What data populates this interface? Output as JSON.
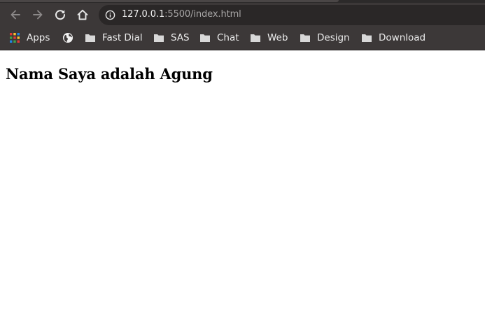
{
  "colors": {
    "chrome_bg": "#3c3838",
    "omnibox_bg": "#2a2727",
    "url_host": "#f1f1f1",
    "url_rest": "#a8a6a6",
    "icon": "#e8e8e8",
    "icon_disabled": "#8b8888",
    "page_bg": "#ffffff",
    "heading": "#000000"
  },
  "toolbar": {
    "back_icon": "arrow-left-icon",
    "forward_icon": "arrow-right-icon",
    "reload_icon": "reload-icon",
    "home_icon": "home-icon"
  },
  "omnibox": {
    "security_icon": "info-icon",
    "url_host": "127.0.0.1",
    "url_rest": ":5500/index.html"
  },
  "bookmarks": [
    {
      "label": "Apps",
      "icon": "apps-grid-icon"
    },
    {
      "label": "",
      "icon": "globe-icon"
    },
    {
      "label": "Fast Dial",
      "icon": "folder-icon"
    },
    {
      "label": "SAS",
      "icon": "folder-icon"
    },
    {
      "label": "Chat",
      "icon": "folder-icon"
    },
    {
      "label": "Web",
      "icon": "folder-icon"
    },
    {
      "label": "Design",
      "icon": "folder-icon"
    },
    {
      "label": "Download",
      "icon": "folder-icon"
    }
  ],
  "page": {
    "heading": "Nama Saya adalah Agung"
  }
}
